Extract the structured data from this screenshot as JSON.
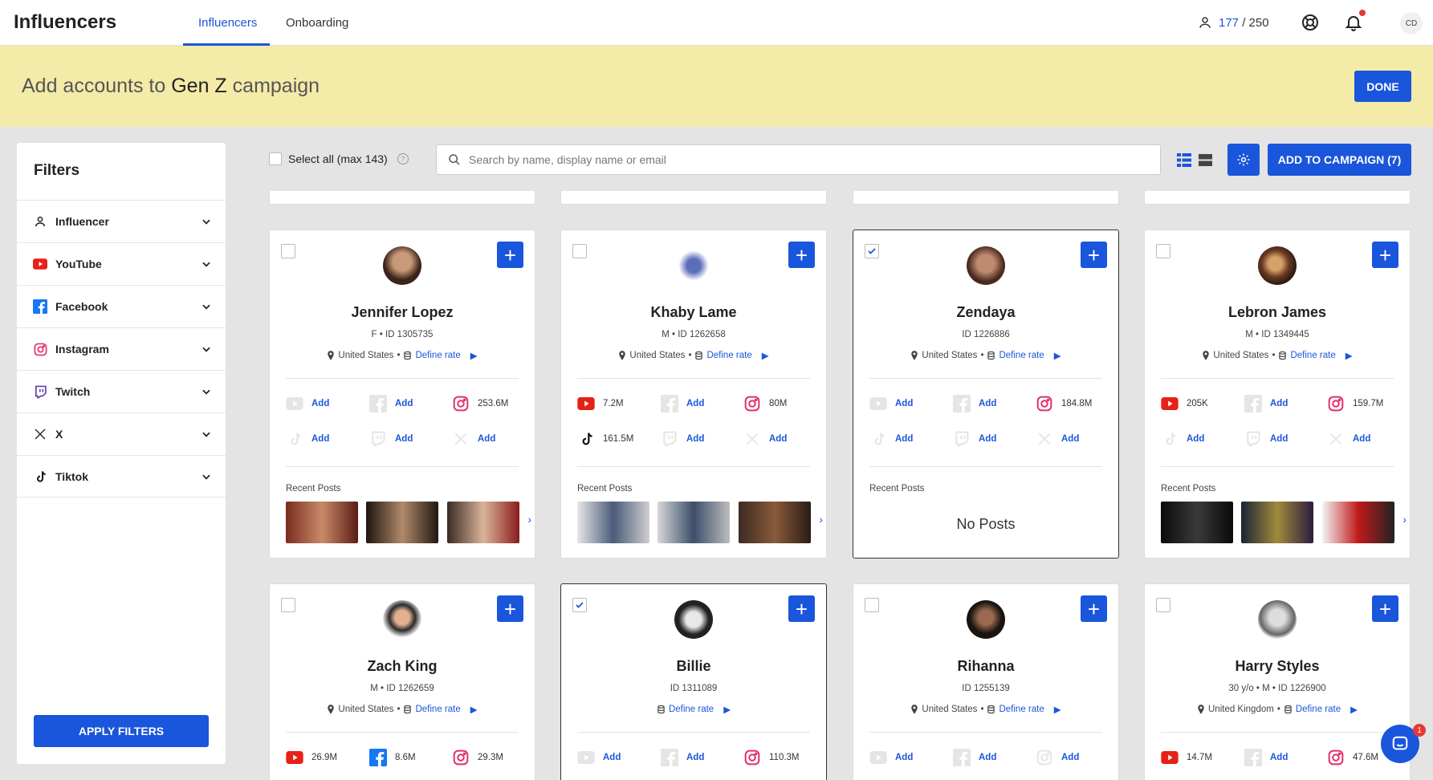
{
  "brand": "Influencers",
  "nav": {
    "tabs": [
      "Influencers",
      "Onboarding"
    ],
    "active": "Influencers"
  },
  "quota": {
    "used": "177",
    "separator": " / ",
    "total": "250"
  },
  "user": {
    "initials": "CD"
  },
  "banner": {
    "prefix": "Add accounts to ",
    "campaign": "Gen Z",
    "suffix": " campaign",
    "done_label": "DONE"
  },
  "filters": {
    "title": "Filters",
    "items": [
      "Influencer",
      "YouTube",
      "Facebook",
      "Instagram",
      "Twitch",
      "X",
      "Tiktok"
    ],
    "apply_label": "APPLY FILTERS"
  },
  "toolbar": {
    "select_all_label": "Select all (max 143)",
    "search_placeholder": "Search by name, display name or email",
    "add_to_campaign_label": "ADD TO CAMPAIGN (7)"
  },
  "labels": {
    "define_rate": "Define rate",
    "add": "Add",
    "recent_posts": "Recent Posts",
    "no_posts": "No Posts"
  },
  "chat": {
    "badge": "1"
  },
  "cards": [
    {
      "name": "Jennifer Lopez",
      "gender": "F",
      "id": "ID 1305735",
      "location": "United States",
      "selected": false,
      "youtube": "Add",
      "facebook": "Add",
      "instagram": "253.6M",
      "tiktok": "Add",
      "twitch": "Add",
      "x": "Add",
      "posts": true
    },
    {
      "name": "Khaby Lame",
      "gender": "M",
      "id": "ID 1262658",
      "location": "United States",
      "selected": false,
      "youtube": "7.2M",
      "facebook": "Add",
      "instagram": "80M",
      "tiktok": "161.5M",
      "twitch": "Add",
      "x": "Add",
      "posts": true
    },
    {
      "name": "Zendaya",
      "gender": "",
      "id": "ID 1226886",
      "location": "United States",
      "selected": true,
      "youtube": "Add",
      "facebook": "Add",
      "instagram": "184.8M",
      "tiktok": "Add",
      "twitch": "Add",
      "x": "Add",
      "posts": false
    },
    {
      "name": "Lebron James",
      "gender": "M",
      "id": "ID 1349445",
      "location": "United States",
      "selected": false,
      "youtube": "205K",
      "facebook": "Add",
      "instagram": "159.7M",
      "tiktok": "Add",
      "twitch": "Add",
      "x": "Add",
      "posts": true
    },
    {
      "name": "Zach King",
      "gender": "M",
      "id": "ID 1262659",
      "location": "United States",
      "selected": false,
      "youtube": "26.9M",
      "facebook": "8.6M",
      "instagram": "29.3M"
    },
    {
      "name": "Billie",
      "gender": "",
      "id": "ID 1311089",
      "location": "",
      "selected": true,
      "youtube": "Add",
      "facebook": "Add",
      "instagram": "110.3M"
    },
    {
      "name": "Rihanna",
      "gender": "",
      "id": "ID 1255139",
      "location": "United States",
      "selected": false,
      "youtube": "Add",
      "facebook": "Add",
      "instagram": "Add"
    },
    {
      "name": "Harry Styles",
      "gender": "30 y/o • M",
      "id": "ID 1226900",
      "location": "United Kingdom",
      "selected": false,
      "youtube": "14.7M",
      "facebook": "Add",
      "instagram": "47.6M"
    }
  ]
}
